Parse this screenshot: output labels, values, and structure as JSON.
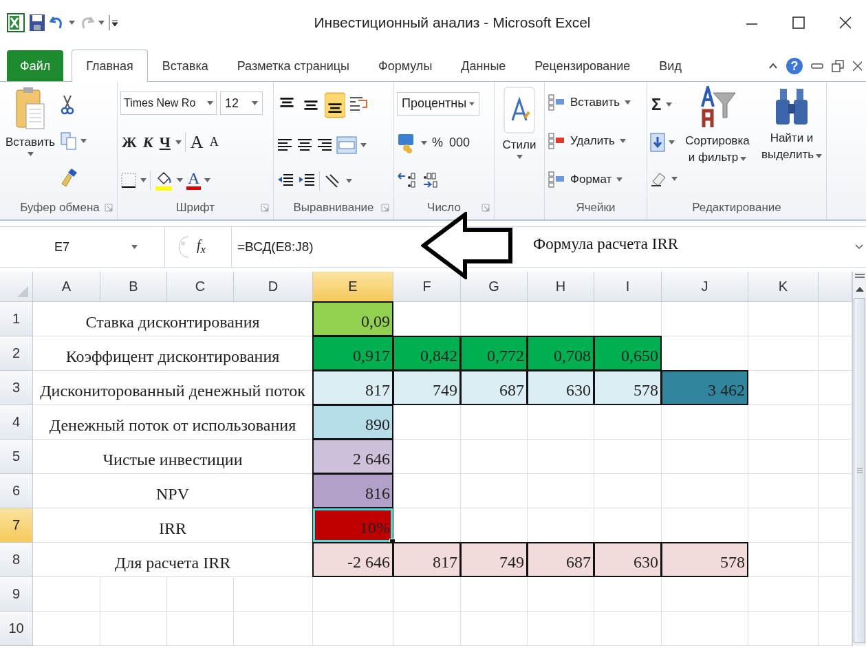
{
  "window": {
    "title": "Инвестиционный анализ  -  Microsoft Excel"
  },
  "tabs": [
    {
      "label": "Файл",
      "kind": "file",
      "selected": false
    },
    {
      "label": "Главная",
      "kind": "tab",
      "selected": true
    },
    {
      "label": "Вставка",
      "kind": "tab",
      "selected": false
    },
    {
      "label": "Разметка страницы",
      "kind": "tab",
      "selected": false
    },
    {
      "label": "Формулы",
      "kind": "tab",
      "selected": false
    },
    {
      "label": "Данные",
      "kind": "tab",
      "selected": false
    },
    {
      "label": "Рецензирование",
      "kind": "tab",
      "selected": false
    },
    {
      "label": "Вид",
      "kind": "tab",
      "selected": false
    }
  ],
  "help": "?",
  "ribbon": {
    "clipboard": {
      "paste": "Вставить",
      "group": "Буфер обмена"
    },
    "font": {
      "name": "Times New Ro",
      "size": "12",
      "bold": "Ж",
      "italic": "К",
      "underline": "Ч",
      "grow": "A",
      "shrink": "A",
      "color_glyph": "A",
      "group": "Шрифт"
    },
    "alignment": {
      "vertical": [
        {
          "selected": false
        },
        {
          "selected": false
        },
        {
          "selected": true
        }
      ],
      "group": "Выравнивание"
    },
    "number": {
      "format": "Процентны",
      "percent": "%",
      "thousands": "000",
      "group": "Число"
    },
    "styles": {
      "label": "Стили"
    },
    "cells": {
      "items": [
        "Вставить",
        "Удалить",
        "Формат"
      ],
      "group": "Ячейки"
    },
    "editing": {
      "sigma": "Σ",
      "sort": "Сортировка и фильтр",
      "find": "Найти и выделить",
      "group": "Редактирование"
    }
  },
  "formula_bar": {
    "name_box": "E7",
    "fx": "f$_{x}$",
    "formula": "=ВСД(E8:J8)"
  },
  "annotation": {
    "text": "Формула расчета IRR"
  },
  "sheet": {
    "columns": [
      {
        "label": "A",
        "selected": false
      },
      {
        "label": "B",
        "selected": false
      },
      {
        "label": "C",
        "selected": false
      },
      {
        "label": "D",
        "selected": false
      },
      {
        "label": "E",
        "selected": true
      },
      {
        "label": "F",
        "selected": false
      },
      {
        "label": "G",
        "selected": false
      },
      {
        "label": "H",
        "selected": false
      },
      {
        "label": "I",
        "selected": false
      },
      {
        "label": "J",
        "selected": false
      },
      {
        "label": "K",
        "selected": false
      }
    ],
    "rows": [
      {
        "number": "1",
        "selected": false,
        "label": "Ставка дисконтирования",
        "values": [
          {
            "text": "0,09",
            "color": "#92d050",
            "selected": false
          }
        ]
      },
      {
        "number": "2",
        "selected": false,
        "label": "Коэффицент дисконтирования",
        "values": [
          {
            "text": "0,917",
            "color": "#00b050",
            "selected": false
          },
          {
            "text": "0,842",
            "color": "#00b050",
            "selected": false
          },
          {
            "text": "0,772",
            "color": "#00b050",
            "selected": false
          },
          {
            "text": "0,708",
            "color": "#00b050",
            "selected": false
          },
          {
            "text": "0,650",
            "color": "#00b050",
            "selected": false
          }
        ]
      },
      {
        "number": "3",
        "selected": false,
        "label": "Дискониторованный денежный поток",
        "values": [
          {
            "text": "817",
            "color": "#daeef3",
            "selected": false
          },
          {
            "text": "749",
            "color": "#daeef3",
            "selected": false
          },
          {
            "text": "687",
            "color": "#daeef3",
            "selected": false
          },
          {
            "text": "630",
            "color": "#daeef3",
            "selected": false
          },
          {
            "text": "578",
            "color": "#daeef3",
            "selected": false
          },
          {
            "text": "3 462",
            "color": "#31859c",
            "selected": false
          }
        ]
      },
      {
        "number": "4",
        "selected": false,
        "label": "Денежный поток от использования",
        "values": [
          {
            "text": "890",
            "color": "#b7dde8",
            "selected": false
          }
        ]
      },
      {
        "number": "5",
        "selected": false,
        "label": "Чистые инвестиции",
        "values": [
          {
            "text": "2 646",
            "color": "#ccc0da",
            "selected": false
          }
        ]
      },
      {
        "number": "6",
        "selected": false,
        "label": "NPV",
        "values": [
          {
            "text": "816",
            "color": "#b1a0c7",
            "selected": false
          }
        ]
      },
      {
        "number": "7",
        "selected": true,
        "label": "IRR",
        "values": [
          {
            "text": "10%",
            "color": "#c00000",
            "selected": true
          }
        ]
      },
      {
        "number": "8",
        "selected": false,
        "label": "Для расчета IRR",
        "values": [
          {
            "text": "-2 646",
            "color": "#f2dcdb",
            "selected": false
          },
          {
            "text": "817",
            "color": "#f2dcdb",
            "selected": false
          },
          {
            "text": "749",
            "color": "#f2dcdb",
            "selected": false
          },
          {
            "text": "687",
            "color": "#f2dcdb",
            "selected": false
          },
          {
            "text": "630",
            "color": "#f2dcdb",
            "selected": false
          },
          {
            "text": "578",
            "color": "#f2dcdb",
            "selected": false
          }
        ]
      },
      {
        "number": "9",
        "selected": false
      },
      {
        "number": "10",
        "selected": false
      }
    ]
  }
}
